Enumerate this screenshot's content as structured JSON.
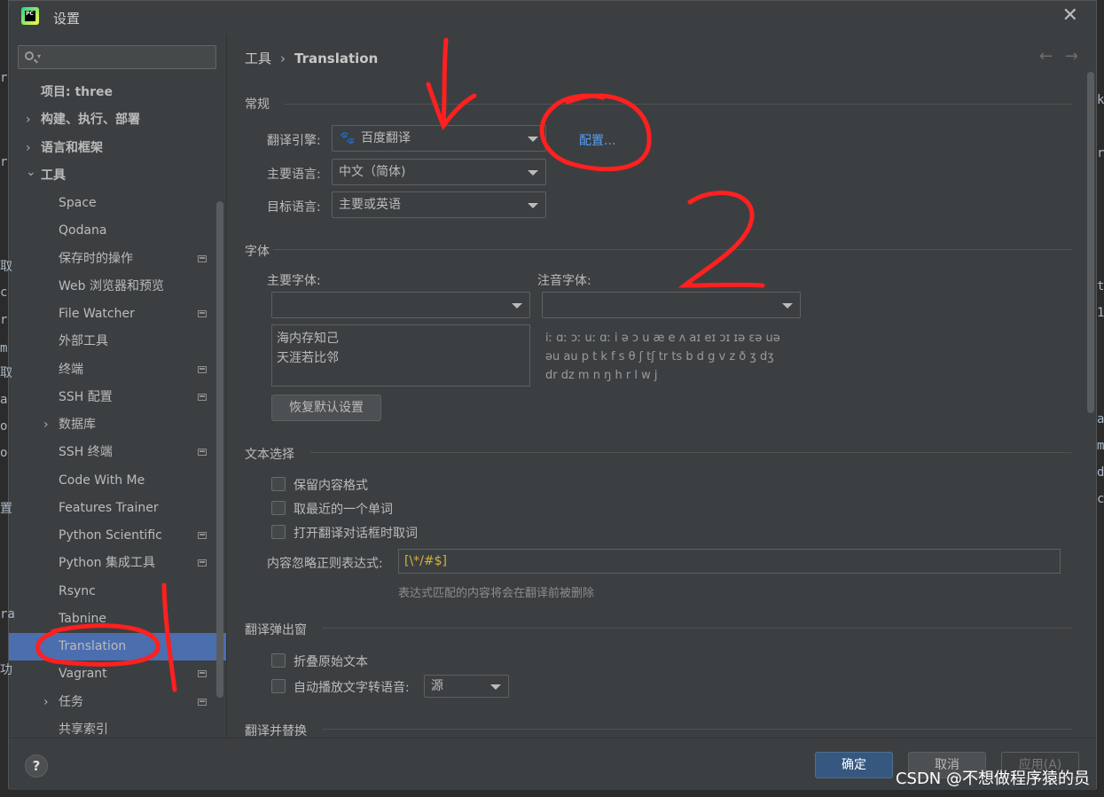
{
  "dialog": {
    "title": "设置",
    "close_label": "✕"
  },
  "background": {
    "left_glyphs": [
      "r",
      "r",
      "取",
      "c",
      "r",
      "m",
      "取",
      "a",
      "o",
      "o",
      "置",
      "ra",
      "功"
    ],
    "right_glyphs": [
      "k",
      "r",
      "t",
      "1",
      "a",
      "m",
      "d",
      "c"
    ]
  },
  "search": {
    "placeholder": ""
  },
  "tree": [
    {
      "label": "项目: three",
      "indent": 0,
      "arrow": "",
      "badge": false,
      "bold": true
    },
    {
      "label": "构建、执行、部署",
      "indent": 0,
      "arrow": "›",
      "badge": false,
      "bold": true
    },
    {
      "label": "语言和框架",
      "indent": 0,
      "arrow": "›",
      "badge": false,
      "bold": true
    },
    {
      "label": "工具",
      "indent": 0,
      "arrow": "⌄",
      "badge": false,
      "bold": true
    },
    {
      "label": "Space",
      "indent": 1,
      "arrow": "",
      "badge": false
    },
    {
      "label": "Qodana",
      "indent": 1,
      "arrow": "",
      "badge": false
    },
    {
      "label": "保存时的操作",
      "indent": 1,
      "arrow": "",
      "badge": true
    },
    {
      "label": "Web 浏览器和预览",
      "indent": 1,
      "arrow": "",
      "badge": false
    },
    {
      "label": "File Watcher",
      "indent": 1,
      "arrow": "",
      "badge": true
    },
    {
      "label": "外部工具",
      "indent": 1,
      "arrow": "",
      "badge": false
    },
    {
      "label": "终端",
      "indent": 1,
      "arrow": "",
      "badge": true
    },
    {
      "label": "SSH 配置",
      "indent": 1,
      "arrow": "",
      "badge": true
    },
    {
      "label": "数据库",
      "indent": 1,
      "arrow": "›",
      "badge": false
    },
    {
      "label": "SSH 终端",
      "indent": 1,
      "arrow": "",
      "badge": true
    },
    {
      "label": "Code With Me",
      "indent": 1,
      "arrow": "",
      "badge": false
    },
    {
      "label": "Features Trainer",
      "indent": 1,
      "arrow": "",
      "badge": false
    },
    {
      "label": "Python Scientific",
      "indent": 1,
      "arrow": "",
      "badge": true
    },
    {
      "label": "Python 集成工具",
      "indent": 1,
      "arrow": "",
      "badge": true
    },
    {
      "label": "Rsync",
      "indent": 1,
      "arrow": "",
      "badge": false
    },
    {
      "label": "Tabnine",
      "indent": 1,
      "arrow": "",
      "badge": false
    },
    {
      "label": "Translation",
      "indent": 1,
      "arrow": "",
      "badge": false,
      "selected": true
    },
    {
      "label": "Vagrant",
      "indent": 1,
      "arrow": "",
      "badge": true
    },
    {
      "label": "任务",
      "indent": 1,
      "arrow": "›",
      "badge": true
    },
    {
      "label": "共享索引",
      "indent": 1,
      "arrow": "",
      "badge": false
    }
  ],
  "breadcrumb": {
    "parent": "工具",
    "sep": "›",
    "current": "Translation"
  },
  "nav": {
    "back": "←",
    "forward": "→"
  },
  "general": {
    "title": "常规",
    "engine_label": "翻译引擎:",
    "engine_value": "百度翻译",
    "configure_link": "配置...",
    "primary_lang_label": "主要语言:",
    "primary_lang_value": "中文（简体)",
    "target_lang_label": "目标语言:",
    "target_lang_value": "主要或英语"
  },
  "font": {
    "title": "字体",
    "primary_label": "主要字体:",
    "phonetic_label": "注音字体:",
    "primary_value": "",
    "phonetic_value": "",
    "preview_lines": [
      "海内存知己",
      "天涯若比邻"
    ],
    "ipa_lines": [
      "iː ɑː ɔː uː ɑː i ə ɔ u æ e ʌ aɪ eɪ ɔɪ ɪə ɛə uə",
      "əu au p t k f s θ ʃ tʃ tr ts b d g v z ð ʒ dʒ",
      "dr dz m n ŋ h r l w j"
    ],
    "reset_button": "恢复默认设置"
  },
  "text_select": {
    "title": "文本选择",
    "options": [
      "保留内容格式",
      "取最近的一个单词",
      "打开翻译对话框时取词"
    ],
    "regex_label": "内容忽略正则表达式:",
    "regex_value": "[\\*/#$]",
    "regex_hint": "表达式匹配的内容将会在翻译前被删除"
  },
  "popup": {
    "title": "翻译弹出窗",
    "fold_label": "折叠原始文本",
    "tts_label": "自动播放文字转语音:",
    "tts_value": "源"
  },
  "replace": {
    "title": "翻译并替换"
  },
  "footer": {
    "help": "?",
    "ok": "确定",
    "cancel": "取消",
    "apply": "应用(A)"
  },
  "watermark": "CSDN @不想做程序猿的员",
  "colors": {
    "accent": "#4b6eaf",
    "annotation": "#ff2020",
    "link": "#589df6"
  }
}
